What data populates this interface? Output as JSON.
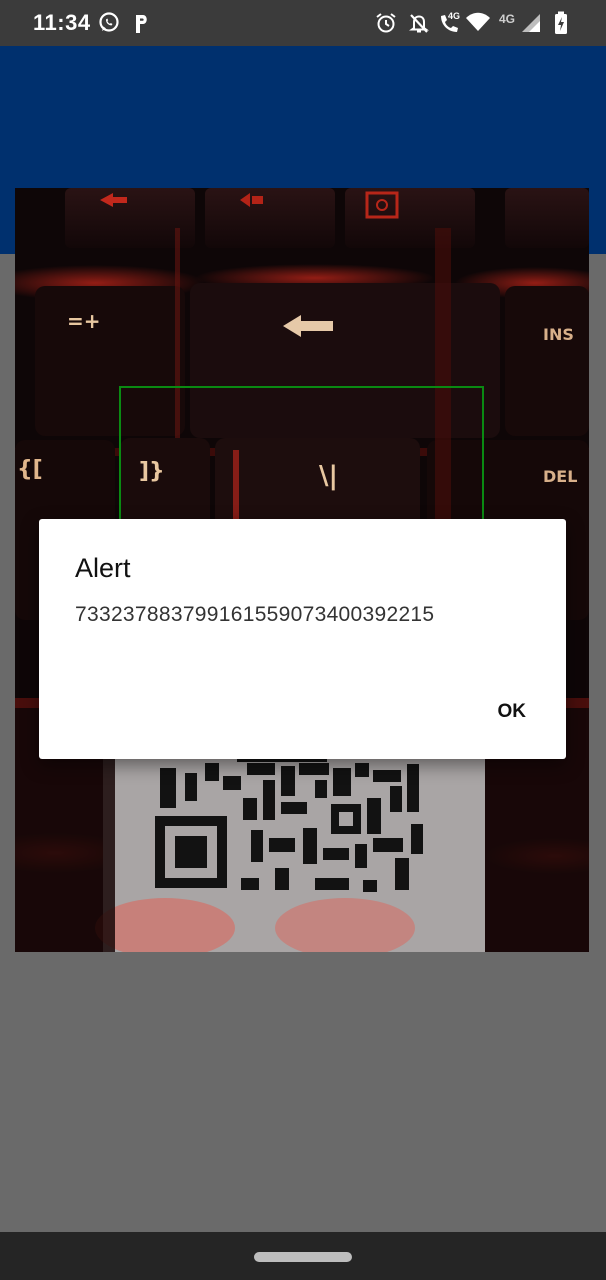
{
  "status_bar": {
    "time": "11:34",
    "network_label_1": "4G",
    "network_label_2": "4G",
    "icons": [
      "whatsapp-icon",
      "parking-p-icon",
      "alarm-icon",
      "notifications-off-icon",
      "volte-call-icon",
      "wifi-icon",
      "cell-signal-icon",
      "battery-charging-icon"
    ]
  },
  "camera": {
    "keyboard_keys": [
      "=+",
      "INS",
      "]}",
      "\\|",
      "DEL",
      "{["
    ]
  },
  "alert": {
    "title": "Alert",
    "message": "73323788379916155907340039221​5",
    "ok_label": "OK"
  },
  "colors": {
    "header": "#00306e",
    "scan_frame": "#0a8a12",
    "background": "#6a6a6a"
  }
}
